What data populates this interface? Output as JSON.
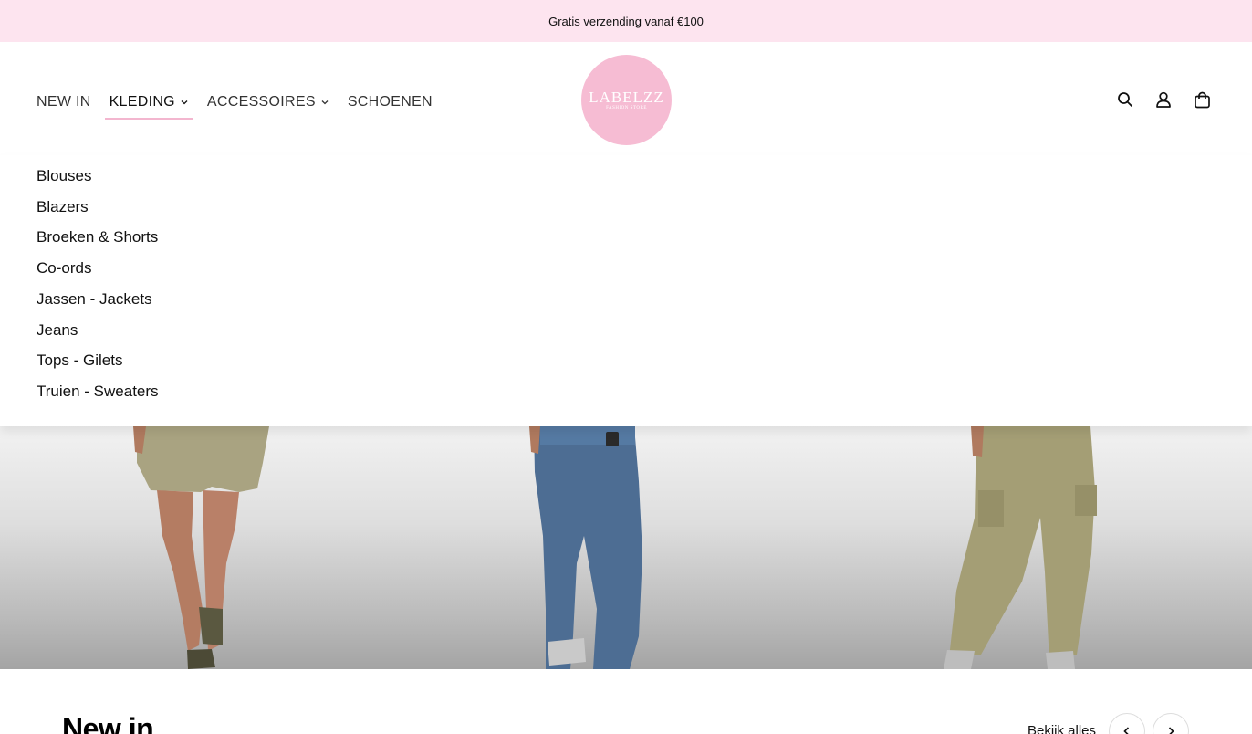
{
  "announcement": "Gratis verzending vanaf €100",
  "nav": {
    "items": [
      {
        "label": "NEW IN",
        "has_dropdown": false
      },
      {
        "label": "KLEDING",
        "has_dropdown": true,
        "active": true
      },
      {
        "label": "ACCESSOIRES",
        "has_dropdown": true
      },
      {
        "label": "SCHOENEN",
        "has_dropdown": false
      }
    ]
  },
  "logo": {
    "text": "LABELZZ",
    "subtext": "FASHION STORE"
  },
  "header_icons": [
    "search-icon",
    "account-icon",
    "cart-icon"
  ],
  "dropdown": {
    "items": [
      "Blouses",
      "Blazers",
      "Broeken & Shorts",
      "Co-ords",
      "Jassen - Jackets",
      "Jeans",
      "Tops - Gilets",
      "Truien - Sweaters"
    ]
  },
  "section": {
    "title": "New in",
    "view_all": "Bekijk alles"
  },
  "colors": {
    "announcement_bg": "#fde4ef",
    "logo_bg": "#f6bcd3",
    "active_underline": "#f3b6cf"
  }
}
